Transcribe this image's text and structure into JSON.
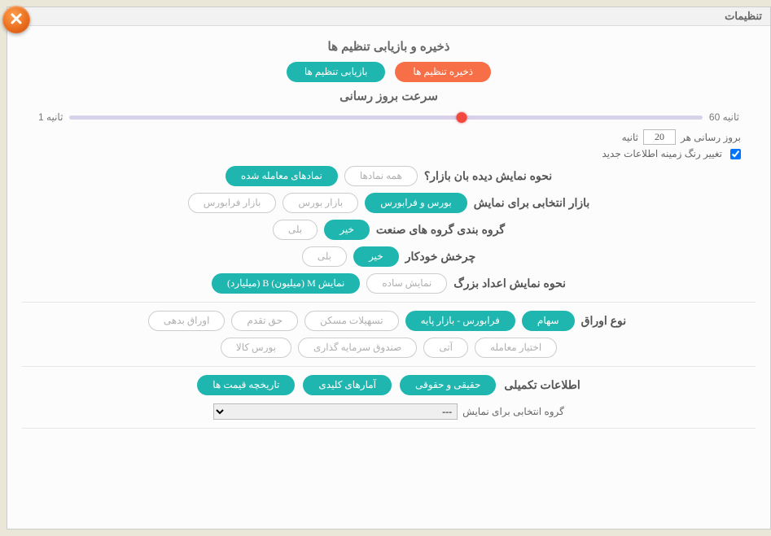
{
  "window": {
    "title": "تنظیمات"
  },
  "save_restore": {
    "heading": "ذخیره و بازیابی تنظیم ها",
    "save_btn": "ذخیره تنظیم ها",
    "restore_btn": "بازیابی تنظیم ها"
  },
  "refresh": {
    "heading": "سرعت بروز رسانی",
    "max_label": "ثانیه 60",
    "min_label": "ثانیه 1",
    "thumb_percent": 62,
    "every_prefix": "بروز رسانی هر",
    "value": "20",
    "every_suffix": "ثانیه",
    "bg_color_label": "تغییر رنگ زمینه اطلاعات جدید"
  },
  "watch_mode": {
    "label": "نحوه نمایش دیده بان بازار؟",
    "all": "همه نمادها",
    "traded": "نمادهای معامله شده"
  },
  "market": {
    "label": "بازار انتخابی برای نمایش",
    "both": "بورس و فرابورس",
    "bourse": "بازار بورس",
    "fara": "بازار فرابورس"
  },
  "industry": {
    "label": "گروه بندی گروه های صنعت",
    "no": "خیر",
    "yes": "بلی"
  },
  "autorotate": {
    "label": "چرخش خودکار",
    "no": "خیر",
    "yes": "بلی"
  },
  "bignum": {
    "label": "نحوه نمایش اعداد بزرگ",
    "simple": "نمایش ساده",
    "mb": "نمایش M (میلیون) B (میلیارد)"
  },
  "securities": {
    "label": "نوع اوراق",
    "r1": {
      "stock": "سهام",
      "farabase": "فرابورس - بازار پایه",
      "housing": "تسهیلات مسکن",
      "rights": "حق تقدم",
      "debt": "اوراق بدهی"
    },
    "r2": {
      "option": "اختیار معامله",
      "future": "آتی",
      "fund": "صندوق سرمایه گذاری",
      "commodity": "بورس کالا"
    }
  },
  "info": {
    "label": "اطلاعات تکمیلی",
    "real_legal": "حقیقی و حقوقی",
    "key_stats": "آمارهای کلیدی",
    "price_hist": "تاریخچه قیمت ها"
  },
  "group_select": {
    "label": "گروه انتخابی برای نمایش",
    "selected": "---"
  }
}
